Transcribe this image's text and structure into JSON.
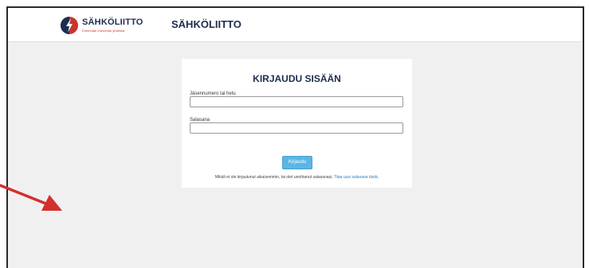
{
  "brand": {
    "name": "SÄHKÖLIITTO",
    "tagline": "Enemmän enemmän yhdessä"
  },
  "header": {
    "title": "SÄHKÖLIITTO"
  },
  "login": {
    "title": "KIRJAUDU SISÄÄN",
    "member_label": "Jäsennumero tai hetu",
    "member_value": "",
    "password_label": "Salasana",
    "password_value": "",
    "submit_label": "Kirjaudu",
    "notice_text": "Mikäli et ole kirjautunut aikaisemmin, tai olet unohtanut salasanasi,",
    "notice_link": "Tilaa uusi salasana tästä."
  },
  "colors": {
    "brand_navy": "#1c2d4f",
    "brand_red": "#c8362b",
    "button": "#5bb6e6",
    "link": "#2a7fc4",
    "annotation_arrow": "#d32f2f"
  },
  "icons": {
    "logo": "lightning-bolt-logo-icon",
    "annotation": "red-arrow-icon"
  }
}
